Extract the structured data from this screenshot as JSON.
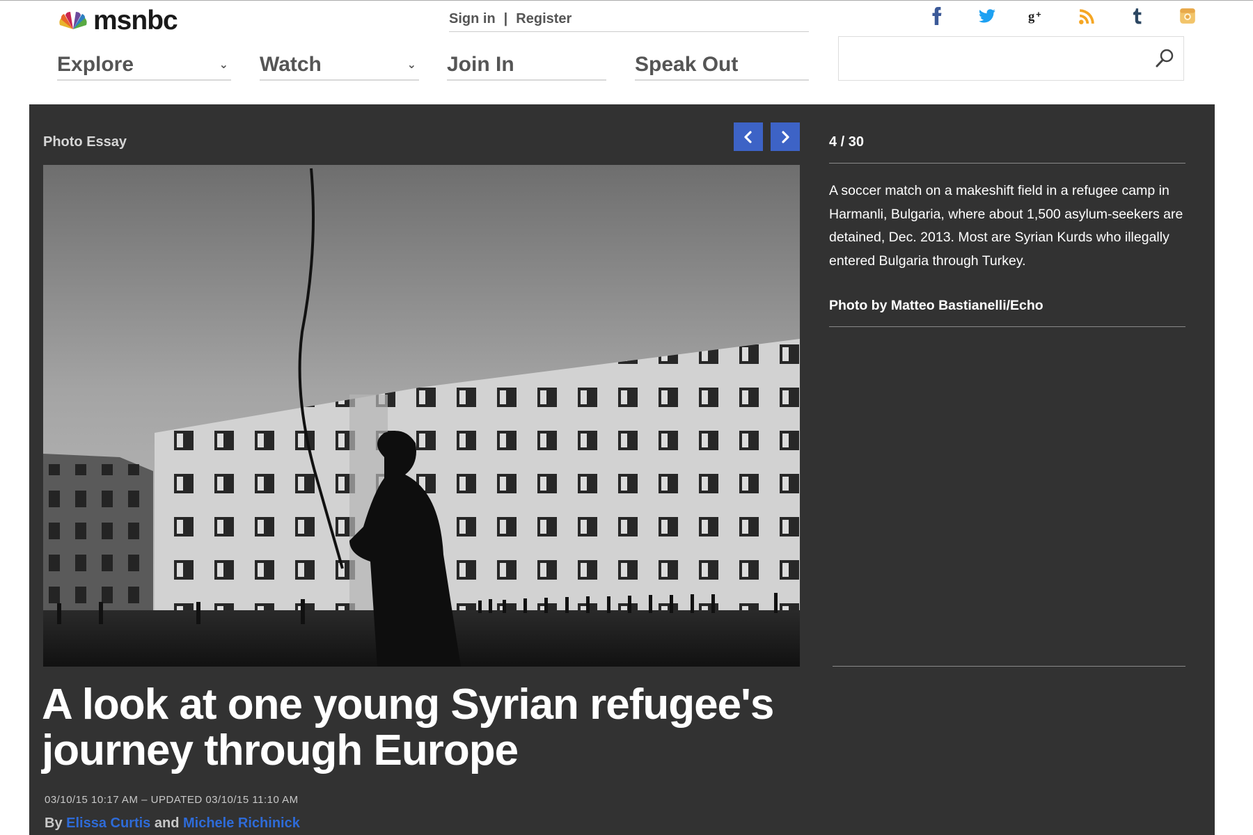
{
  "header": {
    "logo_text": "msnbc",
    "account": {
      "sign_in": "Sign in",
      "separator": "|",
      "register": "Register"
    },
    "social": [
      {
        "icon": "facebook-icon",
        "color": "#3b5998"
      },
      {
        "icon": "twitter-icon",
        "color": "#1da1f2"
      },
      {
        "icon": "google-plus-icon",
        "color": "#222222"
      },
      {
        "icon": "rss-icon",
        "color": "#f5a623"
      },
      {
        "icon": "tumblr-icon",
        "color": "#2c4762"
      },
      {
        "icon": "instagram-icon",
        "color": "#f2c46a"
      }
    ],
    "nav": [
      {
        "label": "Explore",
        "has_dropdown": true
      },
      {
        "label": "Watch",
        "has_dropdown": true
      },
      {
        "label": "Join In",
        "has_dropdown": false
      },
      {
        "label": "Speak Out",
        "has_dropdown": false
      }
    ],
    "search": {
      "value": "",
      "placeholder": ""
    }
  },
  "gallery": {
    "section_label": "Photo Essay",
    "counter": "4 / 30",
    "caption": "A soccer match on a makeshift field in a refugee camp in Harmanli, Bulgaria, where about 1,500 asylum-seekers are detained, Dec. 2013. Most are Syrian Kurds who illegally entered Bulgaria through Turkey.",
    "credit": "Photo by Matteo Bastianelli/Echo"
  },
  "article": {
    "headline": "A look at one young Syrian refugee's journey through Europe",
    "dateline": "03/10/15 10:17 AM – UPDATED 03/10/15 11:10 AM",
    "byline_prefix": "By",
    "author1": "Elissa Curtis",
    "byline_and": "and",
    "author2": "Michele Richinick"
  },
  "colors": {
    "panel": "#323232",
    "arrow_button": "#3d63c6",
    "link": "#2e6bd8"
  }
}
